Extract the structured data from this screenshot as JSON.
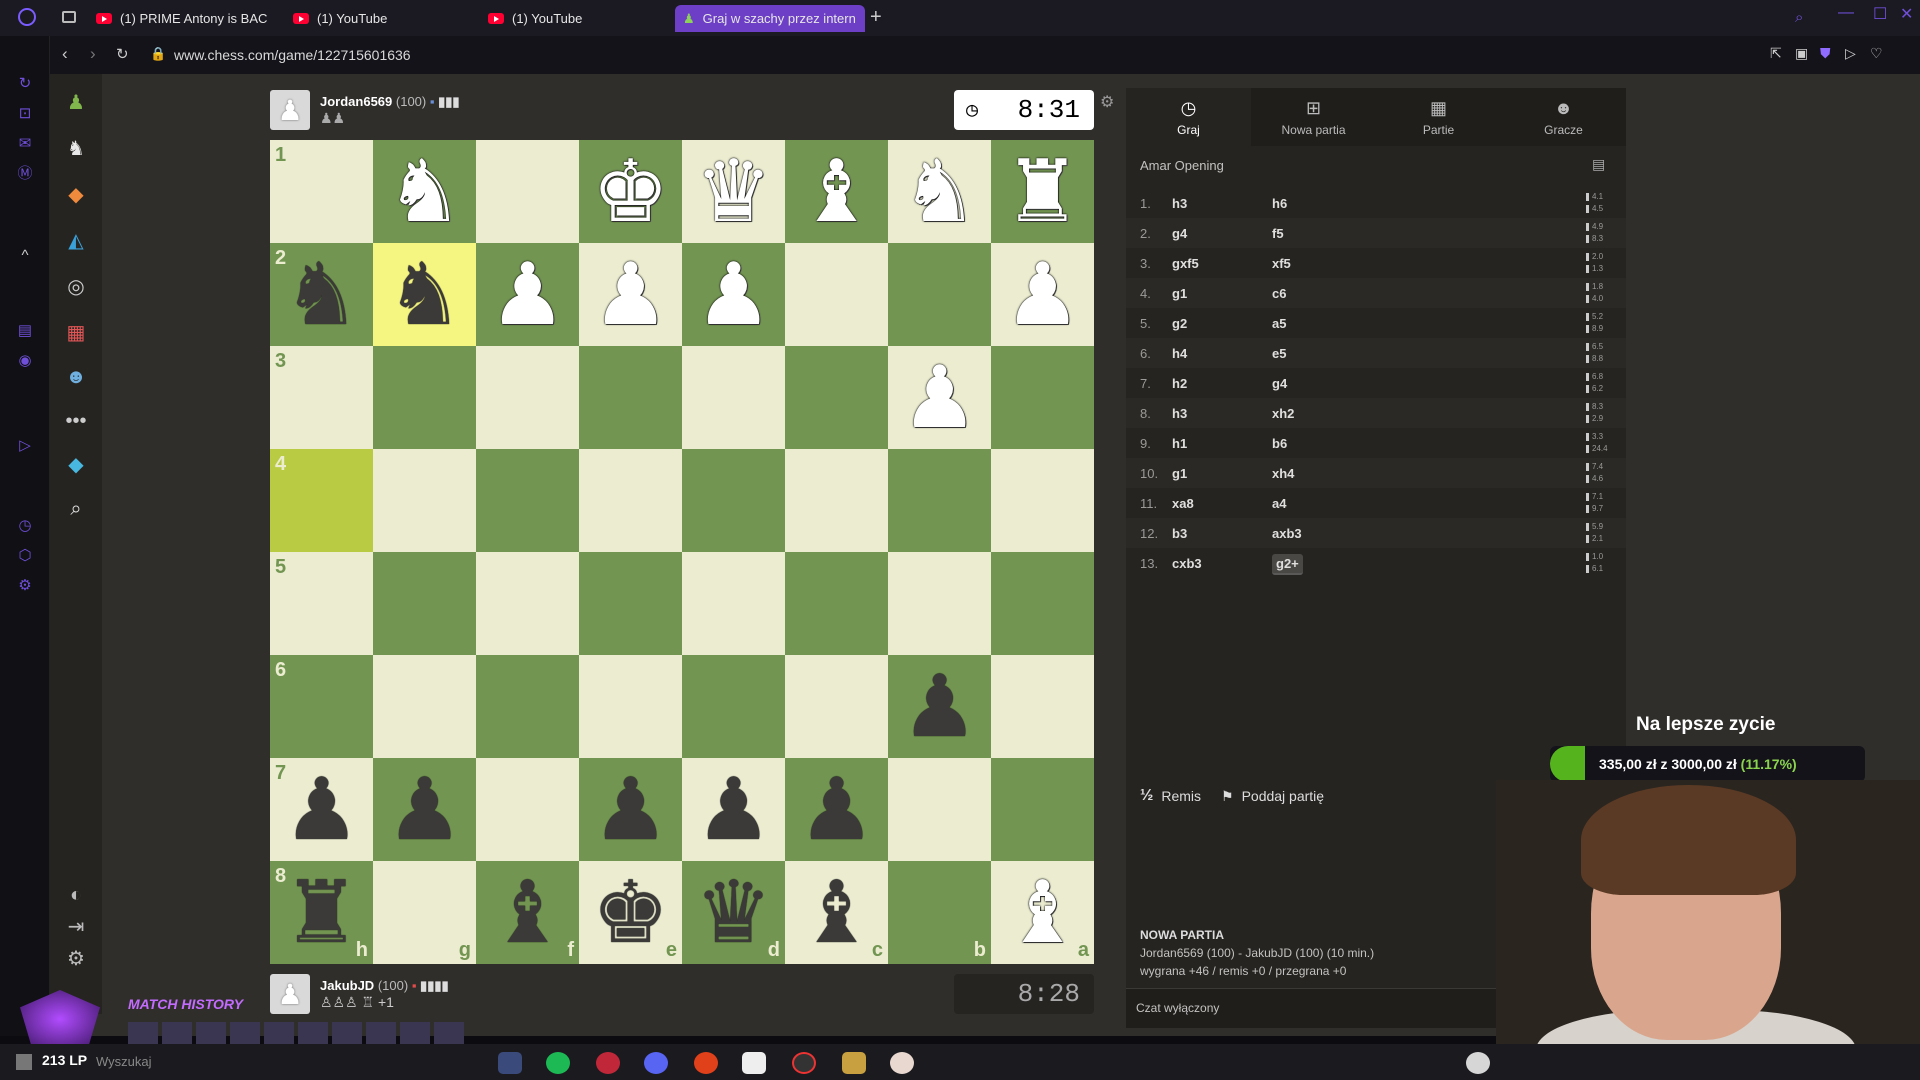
{
  "browser": {
    "tabs": [
      {
        "label": "(1) PRIME Antony is BACK",
        "active": false
      },
      {
        "label": "(1) YouTube",
        "active": false
      },
      {
        "label": "(1) YouTube",
        "active": false
      },
      {
        "label": "Graj w szachy przez intern",
        "active": true
      }
    ],
    "new_tab": "+",
    "url": "www.chess.com/game/122715601636"
  },
  "top_player": {
    "name": "Jordan6569",
    "rating": "(100)",
    "clock": "8:31"
  },
  "bottom_player": {
    "name": "JakubJD",
    "rating": "(100)",
    "captured_extra": "+1",
    "clock": "8:28"
  },
  "board": {
    "rank_labels": [
      "1",
      "2",
      "3",
      "4",
      "5",
      "6",
      "7",
      "8"
    ],
    "file_labels": [
      "h",
      "g",
      "f",
      "e",
      "d",
      "c",
      "b",
      "a"
    ],
    "rows": [
      [
        "",
        "wN",
        "",
        "wK",
        "wQ",
        "wB",
        "wN",
        "wR"
      ],
      [
        "bN",
        "bN",
        "wP",
        "wP",
        "wP",
        "",
        "",
        "wP"
      ],
      [
        "",
        "",
        "",
        "",
        "",
        "",
        "wP",
        ""
      ],
      [
        "",
        "",
        "",
        "",
        "",
        "",
        "",
        ""
      ],
      [
        "",
        "",
        "",
        "",
        "",
        "",
        "",
        ""
      ],
      [
        "",
        "",
        "",
        "",
        "",
        "",
        "bP",
        ""
      ],
      [
        "bP",
        "bP",
        "",
        "bP",
        "bP",
        "bP",
        "",
        ""
      ],
      [
        "bR",
        "",
        "bB",
        "bK",
        "bQ",
        "bB",
        "",
        "wB"
      ]
    ],
    "highlight": [
      [
        1,
        1
      ],
      [
        3,
        0
      ]
    ]
  },
  "panel": {
    "tabs": [
      {
        "label": "Graj",
        "icon": "clock-icon"
      },
      {
        "label": "Nowa partia",
        "icon": "plus-icon"
      },
      {
        "label": "Partie",
        "icon": "board-icon"
      },
      {
        "label": "Gracze",
        "icon": "players-icon"
      }
    ],
    "opening": "Amar Opening",
    "moves": [
      {
        "n": "1.",
        "w": "h3",
        "b": "h6",
        "t1": "4.1",
        "t2": "4.5"
      },
      {
        "n": "2.",
        "w": "g4",
        "b": "f5",
        "t1": "4.9",
        "t2": "8.3"
      },
      {
        "n": "3.",
        "w": "gxf5",
        "b": "xf5",
        "t1": "2.0",
        "t2": "1.3"
      },
      {
        "n": "4.",
        "w": "g1",
        "b": "c6",
        "t1": "1.8",
        "t2": "4.0"
      },
      {
        "n": "5.",
        "w": "g2",
        "b": "a5",
        "t1": "5.2",
        "t2": "8.9"
      },
      {
        "n": "6.",
        "w": "h4",
        "b": "e5",
        "t1": "6.5",
        "t2": "8.8"
      },
      {
        "n": "7.",
        "w": "h2",
        "b": "g4",
        "t1": "6.8",
        "t2": "6.2"
      },
      {
        "n": "8.",
        "w": "h3",
        "b": "xh2",
        "t1": "8.3",
        "t2": "2.9"
      },
      {
        "n": "9.",
        "w": "h1",
        "b": "b6",
        "t1": "3.3",
        "t2": "24.4"
      },
      {
        "n": "10.",
        "w": "g1",
        "b": "xh4",
        "t1": "7.4",
        "t2": "4.6"
      },
      {
        "n": "11.",
        "w": "xa8",
        "b": "a4",
        "t1": "7.1",
        "t2": "9.7"
      },
      {
        "n": "12.",
        "w": "b3",
        "b": "axb3",
        "t1": "5.9",
        "t2": "2.1"
      },
      {
        "n": "13.",
        "w": "cxb3",
        "b": "g2+",
        "t1": "1.0",
        "t2": "6.1"
      }
    ],
    "draw_label": "Remis",
    "draw_icon": "½",
    "resign_label": "Poddaj partię",
    "info_heading": "NOWA PARTIA",
    "info_line1": "Jordan6569 (100) - JakubJD (100) (10 min.)",
    "info_line2": "wygrana +46 / remis +0 / przegrana +0",
    "chat_placeholder": "Czat wyłączony"
  },
  "overlay": {
    "title": "Na lepsze zycie",
    "progress_text": "335,00 zł z 3000,00 zł",
    "progress_pct": "(11.17%)",
    "progress_fraction": 0.1117
  },
  "stream": {
    "match_history": "MATCH HISTORY",
    "lp": "213 LP",
    "search_hint": "Wyszukaj"
  },
  "colors": {
    "board_light": "#ebecd0",
    "board_dark": "#739552",
    "accent": "#6d3fc6"
  }
}
